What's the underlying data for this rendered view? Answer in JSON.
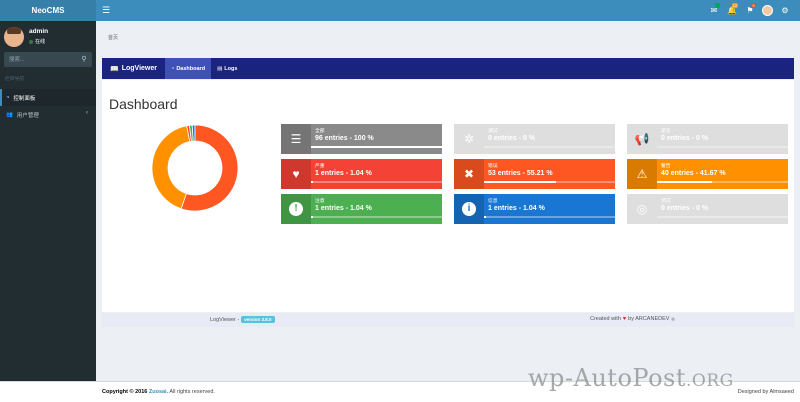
{
  "app": {
    "title": "NeoCMS"
  },
  "topbar": {
    "menu_icon": "hamburger-icon",
    "mail_count": "",
    "notif_count": "10",
    "flag_count": "9"
  },
  "user": {
    "name": "admin",
    "status": "在线"
  },
  "sidebar": {
    "search_placeholder": "搜索...",
    "header": "栏目导航",
    "items": [
      {
        "label": "控制面板",
        "icon": "dashboard-icon"
      },
      {
        "label": "用户管理",
        "icon": "users-icon"
      }
    ]
  },
  "breadcrumb": "首页",
  "logviewer": {
    "brand": "LogViewer",
    "tabs": [
      {
        "label": "Dashboard"
      },
      {
        "label": "Logs"
      }
    ],
    "page_title": "Dashboard"
  },
  "chart_data": {
    "type": "pie",
    "variant": "doughnut",
    "categories": [
      "错误",
      "警告",
      "严重",
      "注意",
      "信息"
    ],
    "values": [
      53,
      40,
      1,
      1,
      1
    ],
    "colors": [
      "#ff5722",
      "#ff9100",
      "#f44336",
      "#4caf50",
      "#1976d2"
    ]
  },
  "levels": [
    {
      "label": "全部",
      "count": "96 entries - 100 %",
      "percent": 100,
      "color": "#8a8a8a",
      "icon": "list-icon",
      "dim": false
    },
    {
      "label": "调试",
      "count": "0 entries - 0 %",
      "percent": 0,
      "color": "#dedede",
      "icon": "bug-icon",
      "dim": true
    },
    {
      "label": "紧急",
      "count": "0 entries - 0 %",
      "percent": 0,
      "color": "#dedede",
      "icon": "bullhorn-icon",
      "dim": true
    },
    {
      "label": "严重",
      "count": "1 entries - 1.04 %",
      "percent": 1.04,
      "color": "#f44336",
      "icon": "heartbeat-icon",
      "dim": false
    },
    {
      "label": "错误",
      "count": "53 entries - 55.21 %",
      "percent": 55.21,
      "color": "#ff5722",
      "icon": "times-circle-icon",
      "dim": false
    },
    {
      "label": "警告",
      "count": "40 entries - 41.67 %",
      "percent": 41.67,
      "color": "#ff9100",
      "icon": "warning-icon",
      "dim": false
    },
    {
      "label": "注意",
      "count": "1 entries - 1.04 %",
      "percent": 1.04,
      "color": "#4caf50",
      "icon": "exclamation-circle-icon",
      "dim": false
    },
    {
      "label": "信息",
      "count": "1 entries - 1.04 %",
      "percent": 1.04,
      "color": "#1976d2",
      "icon": "info-circle-icon",
      "dim": false
    },
    {
      "label": "调试",
      "count": "0 entries - 0 %",
      "percent": 0,
      "color": "#dedede",
      "icon": "life-ring-icon",
      "dim": true
    }
  ],
  "lv_footer": {
    "name": "LogViewer -",
    "version": "version 3.8.0",
    "created_with": "Created with",
    "by": "by ARCANEDEV",
    "reg": "®"
  },
  "footer": {
    "copyright_prefix": "Copyright © 2016",
    "brand": "Zuosai.",
    "suffix": "All rights reserved.",
    "designed": "Designed by Almsaeed"
  },
  "watermark": {
    "text": "wp-AutoPost",
    "suffix": ".ORG"
  }
}
